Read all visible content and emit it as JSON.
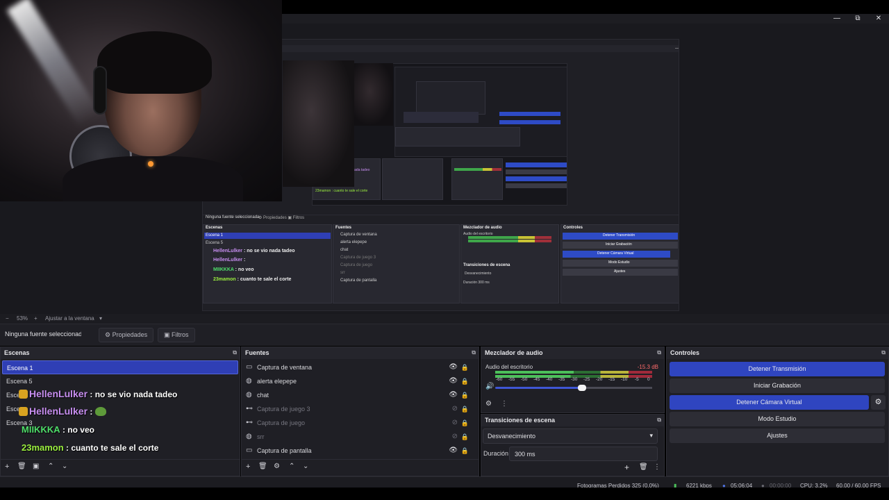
{
  "window": {
    "minimize": "—",
    "maximize": "⧉",
    "close": "✕"
  },
  "zoom": {
    "minus": "−",
    "percent": "53%",
    "plus": "+",
    "fit_label": "Ajustar a la ventana",
    "chevron": "▾"
  },
  "props_bar": {
    "no_source": "Ninguna fuente seleccionada",
    "properties": "Propiedades",
    "filters": "Filtros"
  },
  "scenes": {
    "title": "Escenas",
    "items": [
      "Escena 1",
      "Escena 5",
      "Escena",
      "Escena",
      "Escena 3"
    ],
    "selected_index": 0
  },
  "chat": [
    {
      "user": "HellenLulker",
      "message": " : no se vio nada tadeo",
      "user_color": "#c78ef0"
    },
    {
      "user": "HellenLulker",
      "message": " : ",
      "user_color": "#c78ef0"
    },
    {
      "user": "MIIKKKA",
      "message": " : no veo",
      "user_color": "#4fdf6a"
    },
    {
      "user": "23mamon",
      "message": " : cuanto te sale el corte",
      "user_color": "#9bef3f"
    }
  ],
  "sources": {
    "title": "Fuentes",
    "items": [
      {
        "name": "Captura de ventana",
        "icon": "window-icon",
        "visible": true
      },
      {
        "name": "alerta elepepe",
        "icon": "browser-icon",
        "visible": true
      },
      {
        "name": "chat",
        "icon": "browser-icon",
        "visible": true
      },
      {
        "name": "Captura de juego 3",
        "icon": "gamepad-icon",
        "visible": false
      },
      {
        "name": "Captura de juego",
        "icon": "gamepad-icon",
        "visible": false
      },
      {
        "name": "srr",
        "icon": "browser-icon",
        "visible": false
      },
      {
        "name": "Captura de pantalla",
        "icon": "monitor-icon",
        "visible": true
      }
    ]
  },
  "audio": {
    "title": "Mezclador de audio",
    "device": "Audio del escritorio",
    "level": "-15.3 dB",
    "ticks": [
      "-60",
      "-55",
      "-50",
      "-45",
      "-40",
      "-35",
      "-30",
      "-25",
      "-20",
      "-15",
      "-10",
      "-5",
      "0"
    ],
    "volume_fraction": 0.55
  },
  "transitions": {
    "title": "Transiciones de escena",
    "selected": "Desvanecimiento",
    "duration_label": "Duración",
    "duration_value": "300 ms"
  },
  "controls": {
    "title": "Controles",
    "stop_stream": "Detener Transmisión",
    "start_record": "Iniciar Grabación",
    "stop_vcam": "Detener Cámara Virtual",
    "studio_mode": "Modo Estudio",
    "settings": "Ajustes"
  },
  "status": {
    "dropped": "Fotogramas Perdidos 325 (0.0%)",
    "bitrate": "6221 kbps",
    "stream_time": "05:06:04",
    "record_time": "00:00:00",
    "cpu": "CPU: 3.2%",
    "fps": "60.00 / 60.00 FPS"
  },
  "colors": {
    "accent": "#2f45c0",
    "panel": "#1f1f25",
    "background": "#19191e"
  }
}
